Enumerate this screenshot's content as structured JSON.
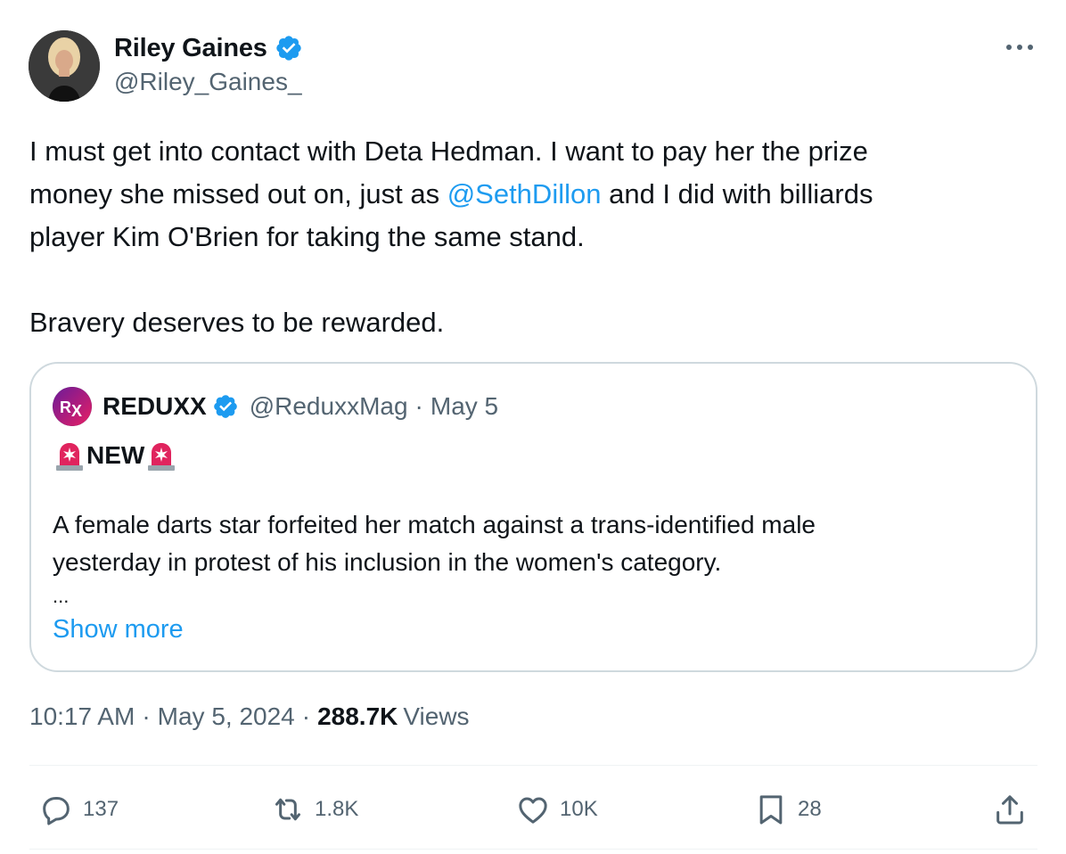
{
  "author": {
    "display_name": "Riley Gaines",
    "handle": "@Riley_Gaines_"
  },
  "tweet": {
    "line1": "I must get into contact with Deta Hedman. I want to pay her the prize",
    "line2_pre": "money she missed out on, just as ",
    "mention": "@SethDillon",
    "line2_post": " and I did with billiards",
    "line3": "player Kim O'Brien for taking the same stand.",
    "line4": "Bravery deserves to be rewarded."
  },
  "quote": {
    "name": "REDUXX",
    "handle": "@ReduxxMag",
    "dot": "·",
    "date": "May 5",
    "tag": "NEW",
    "text_line1": "A female darts star forfeited her match against a trans-identified male",
    "text_line2": "yesterday in protest of his inclusion in the women's category.",
    "ellipsis": "...",
    "show_more": "Show more"
  },
  "meta": {
    "time": "10:17 AM",
    "dot": "·",
    "date": "May 5, 2024",
    "views_count": "288.7K",
    "views_label": "Views"
  },
  "actions": {
    "replies": "137",
    "reposts": "1.8K",
    "likes": "10K",
    "bookmarks": "28"
  },
  "colors": {
    "accent": "#1d9bf0",
    "text_primary": "#0f1419",
    "text_secondary": "#536471",
    "border": "#cfd9de",
    "alert_red": "#e0245e"
  },
  "icons": {
    "verified": "verified-badge-icon",
    "more": "more-horizontal-icon",
    "siren": "police-light-icon",
    "reply": "reply-icon",
    "retweet": "retweet-icon",
    "like": "heart-icon",
    "bookmark": "bookmark-icon",
    "share": "share-icon"
  }
}
